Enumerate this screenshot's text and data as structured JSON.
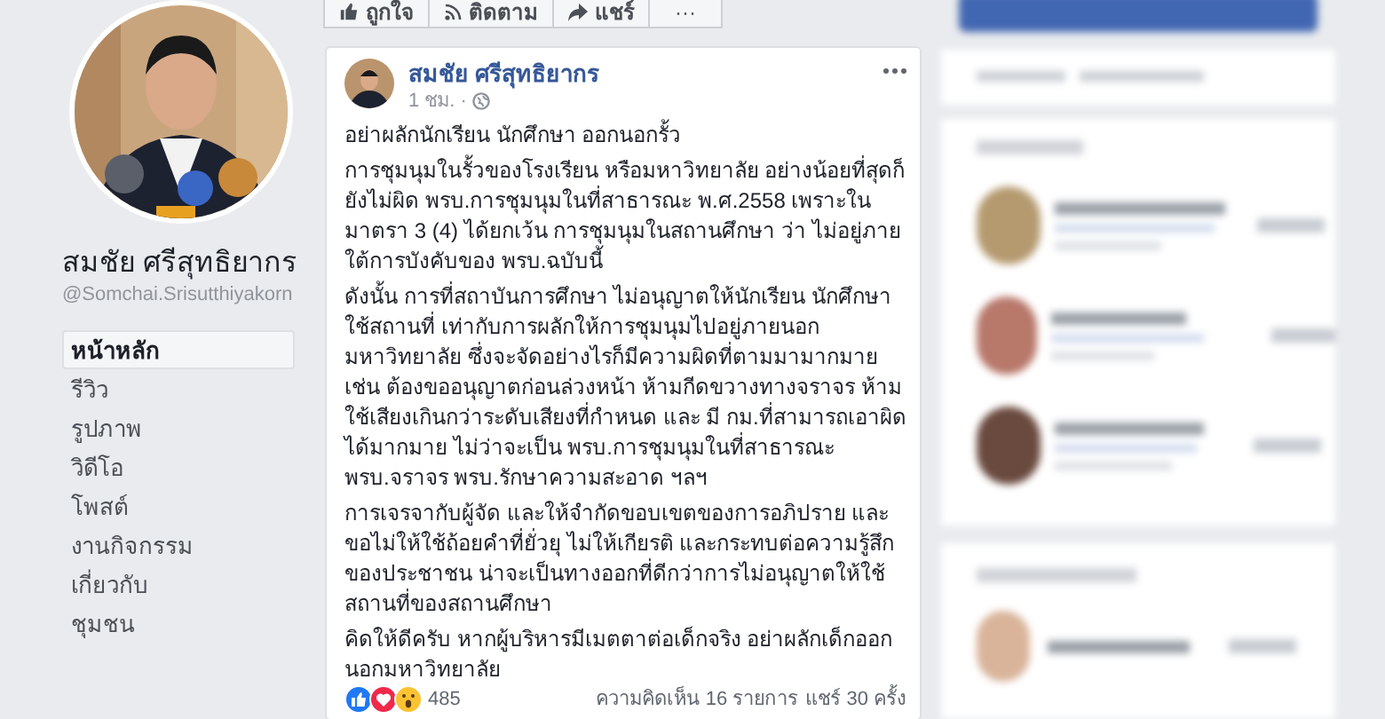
{
  "profile": {
    "name": "สมชัย ศรีสุทธิยากร",
    "handle": "@Somchai.Srisutthiyakorn"
  },
  "nav": [
    {
      "label": "หน้าหลัก",
      "selected": true
    },
    {
      "label": "รีวิว",
      "selected": false
    },
    {
      "label": "รูปภาพ",
      "selected": false
    },
    {
      "label": "วิดีโอ",
      "selected": false
    },
    {
      "label": "โพสต์",
      "selected": false
    },
    {
      "label": "งานกิจกรรม",
      "selected": false
    },
    {
      "label": "เกี่ยวกับ",
      "selected": false
    },
    {
      "label": "ชุมชน",
      "selected": false
    }
  ],
  "actions": [
    {
      "kind": "like",
      "label": "ถูกใจ"
    },
    {
      "kind": "follow",
      "label": "ติดตาม"
    },
    {
      "kind": "share",
      "label": "แชร์"
    },
    {
      "kind": "more",
      "label": "···"
    }
  ],
  "post": {
    "author": "สมชัย ศรีสุทธิยากร",
    "time": "1 ชม. ·",
    "paragraphs": [
      "อย่าผลักนักเรียน นักศึกษา ออกนอกรั้ว",
      "การชุมนุมในรั้วของโรงเรียน หรือมหาวิทยาลัย อย่างน้อยที่สุดก็ยังไม่ผิด พรบ.การชุมนุมในที่สาธารณะ พ.ศ.2558 เพราะในมาตรา 3 (4) ได้ยกเว้น การชุมนุมในสถานศึกษา ว่า ไม่อยู่ภายใต้การบังคับของ พรบ.ฉบับนี้",
      "ดังนั้น การที่สถาบันการศึกษา ไม่อนุญาตให้นักเรียน นักศึกษาใช้สถานที่ เท่ากับการผลักให้การชุมนุมไปอยู่ภายนอกมหาวิทยาลัย ซึ่งจะจัดอย่างไรก็มีความผิดที่ตามมามากมาย เช่น ต้องขออนุญาตก่อนล่วงหน้า ห้ามกีดขวางทางจราจร ห้ามใช้เสียงเกินกว่าระดับเสียงที่กำหนด และ มี กม.ที่สามารถเอาผิดได้มากมาย ไม่ว่าจะเป็น พรบ.การชุมนุมในที่สาธารณะ พรบ.จราจร พรบ.รักษาความสะอาด ฯลฯ",
      "การเจรจากับผู้จัด และให้จำกัดขอบเขตของการอภิปราย และ ขอไม่ให้ใช้ถ้อยคำที่ยั่วยุ ไม่ให้เกียรติ และกระทบต่อความรู้สึกของประชาชน น่าจะเป็นทางออกที่ดีกว่าการไม่อนุญาตให้ใช้สถานที่ของสถานศึกษา",
      "คิดให้ดีครับ หากผู้บริหารมีเมตตาต่อเด็กจริง อย่าผลักเด็กออกนอกมหาวิทยาลัย"
    ],
    "reactions": [
      {
        "kind": "like"
      },
      {
        "kind": "love"
      },
      {
        "kind": "wow"
      }
    ],
    "reaction_count": "485",
    "comments": "ความคิดเห็น 16 รายการ",
    "shares": "แชร์ 30 ครั้ง"
  }
}
